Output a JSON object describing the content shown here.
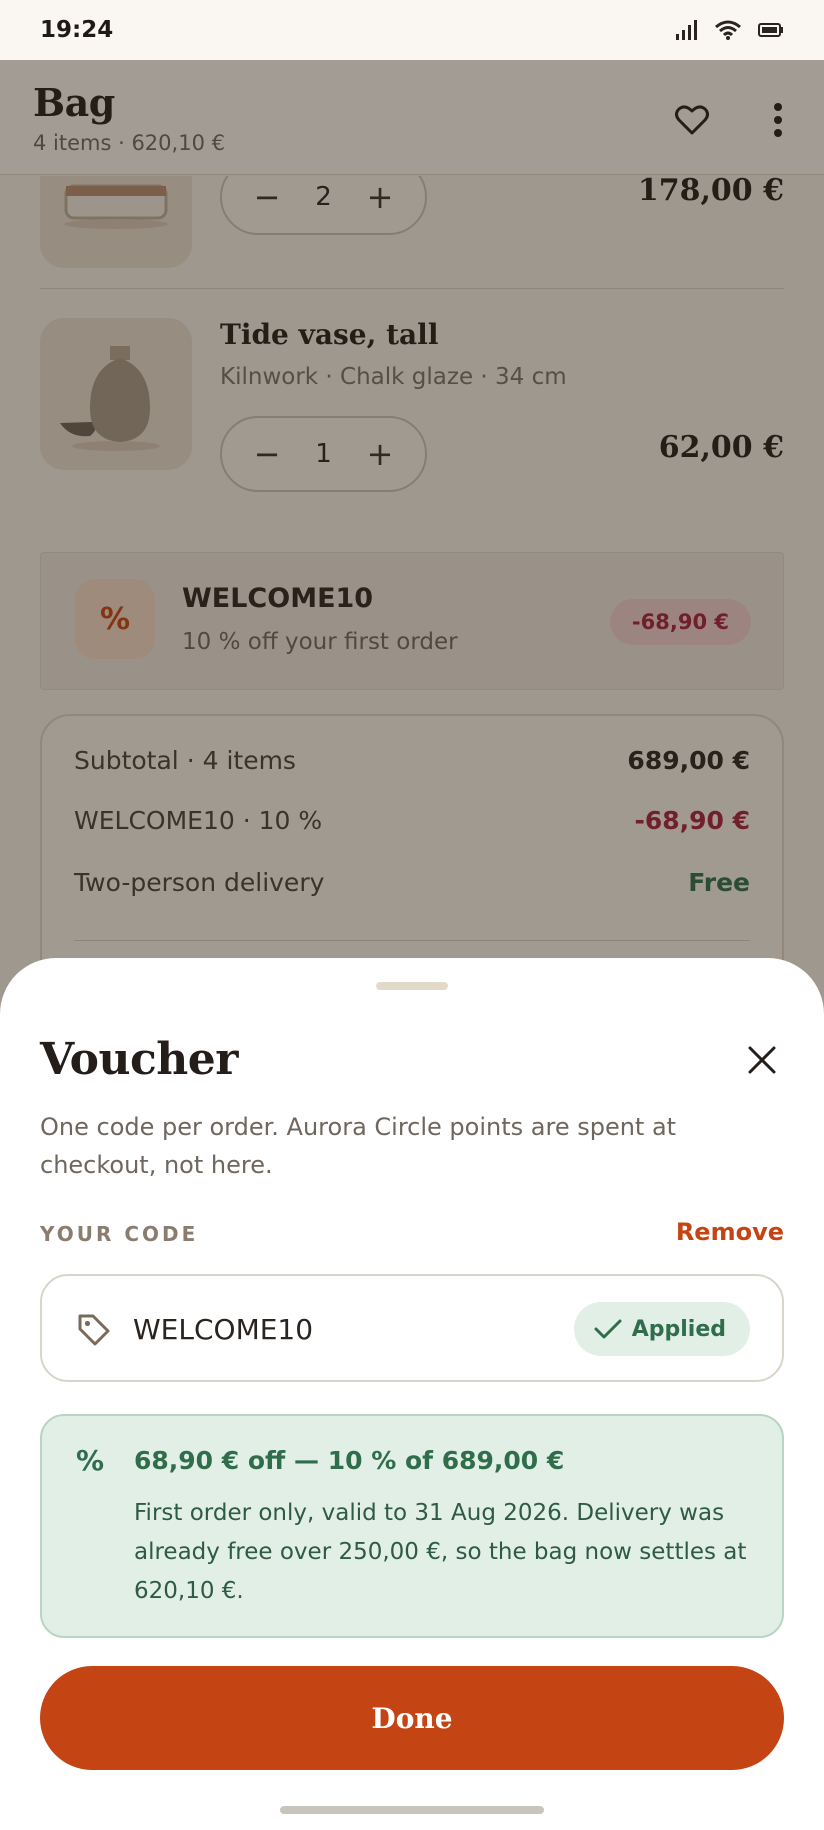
{
  "status_bar": {
    "time": "19:24"
  },
  "header": {
    "title": "Bag",
    "subtitle": "4 items · 620,10 €"
  },
  "items": [
    {
      "qty": "2",
      "price": "178,00 €"
    },
    {
      "name": "Tide vase, tall",
      "meta": "Kilnwork · Chalk glaze · 34 cm",
      "qty": "1",
      "price": "62,00 €"
    }
  ],
  "voucher_row": {
    "icon": "%",
    "code": "WELCOME10",
    "description": "10 % off your first order",
    "badge": "-68,90 €"
  },
  "summary": {
    "rows": [
      {
        "label": "Subtotal · 4 items",
        "value": "689,00 €"
      },
      {
        "label": "WELCOME10 · 10 %",
        "value": "-68,90 €"
      },
      {
        "label": "Two-person delivery",
        "value": "Free"
      }
    ]
  },
  "sheet": {
    "title": "Voucher",
    "description": "One code per order. Aurora Circle points are spent at checkout, not here.",
    "field_label": "YOUR CODE",
    "remove_label": "Remove",
    "code_value": "WELCOME10",
    "applied_label": "Applied",
    "info_icon": "%",
    "info_title": "68,90 € off — 10 % of 689,00 €",
    "info_body": "First order only, valid to 31 Aug 2026. Delivery was already free over 250,00 €, so the bag now settles at 620,10 €.",
    "done_label": "Done"
  },
  "colors": {
    "accent": "#c44513",
    "discount": "#a61f3c",
    "success": "#2f6d4b",
    "success_bg": "#e1efe6"
  }
}
